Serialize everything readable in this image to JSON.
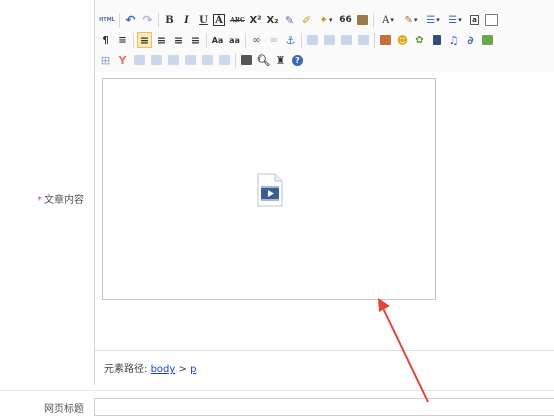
{
  "form": {
    "content_label": "文章内容",
    "required_mark": "*",
    "title_label": "网页标题",
    "title_value": ""
  },
  "toolbar": {
    "html_label": "HTML",
    "bold": "B",
    "italic": "I",
    "underline": "U",
    "frame": "A",
    "strike": "ABC",
    "superscript": "X²",
    "subscript": "X₂",
    "quote": "66",
    "font_color": "A",
    "pilcrow": "¶",
    "upper_case": "Aa",
    "lower_case": "aa",
    "help": "?"
  },
  "statusbar": {
    "path_label": "元素路径:",
    "path_body": "body",
    "path_sep": ">",
    "path_p": "p"
  },
  "colors": {
    "required": "#e2523c",
    "active_button": "#fce9b5",
    "link": "#1a3fd1",
    "arrow": "#e0463a"
  }
}
